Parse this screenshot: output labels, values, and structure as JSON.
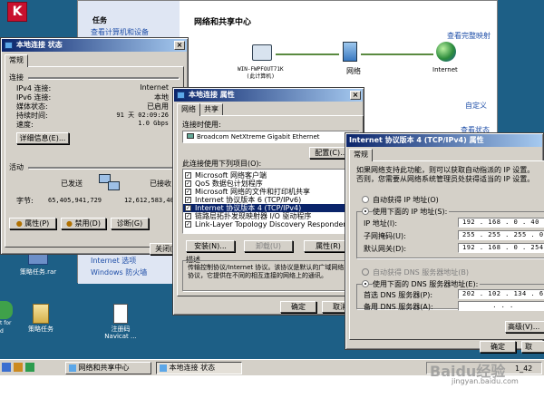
{
  "desktop": {
    "icons": [
      {
        "label": "策略任务.rar"
      },
      {
        "label": "策略任务"
      },
      {
        "label": "注册码\nNavicat ..."
      },
      {
        "label": "t for\nd"
      }
    ]
  },
  "taskbar": {
    "items": [
      "网络和共享中心",
      "本地连接 状态"
    ],
    "time": "1_42",
    "watermark": "Baidu经验",
    "watermark_url": "jingyan.baidu.com"
  },
  "ns_center": {
    "tasks_heading": "任务",
    "link_devices": "查看计算机和设备",
    "title": "网络和共享中心",
    "full_map": "查看完整映射",
    "computer": "WIN-FWPFOUT71K\n(此计算机)",
    "network": "网络",
    "internet": "Internet",
    "customize": "自定义",
    "view_status": "查看状态",
    "bottom_links": [
      "Internet 选项",
      "Windows 防火墙"
    ]
  },
  "status_win": {
    "title": "本地连接 状态",
    "tab": "常规",
    "connection_heading": "连接",
    "rows": [
      {
        "label": "IPv4 连接:",
        "value": "Internet"
      },
      {
        "label": "IPv6 连接:",
        "value": "本地"
      },
      {
        "label": "媒体状态:",
        "value": "已启用"
      },
      {
        "label": "持续时间:",
        "value": "91 天 02:09:26"
      },
      {
        "label": "速度:",
        "value": "1.0 Gbps"
      }
    ],
    "details_btn": "详细信息(E)...",
    "activity_heading": "活动",
    "sent": "已发送",
    "received": "已接收",
    "bytes_label": "字节:",
    "bytes_sent": "65,405,941,729",
    "bytes_received": "12,612,583,401",
    "btn_properties": "属性(P)",
    "btn_disable": "禁用(D)",
    "btn_diagnose": "诊断(G)",
    "btn_close": "关闭(C)"
  },
  "props_win": {
    "title": "本地连接 属性",
    "tabs": [
      "网络",
      "共享"
    ],
    "connect_using": "连接时使用:",
    "adapter": "Broadcom NetXtreme Gigabit Ethernet",
    "configure": "配置(C)...",
    "items_label": "此连接使用下列项目(O):",
    "items": [
      {
        "label": "Microsoft 网络客户端",
        "checked": true
      },
      {
        "label": "QoS 数据包计划程序",
        "checked": true
      },
      {
        "label": "Microsoft 网络的文件和打印机共享",
        "checked": true
      },
      {
        "label": "Internet 协议版本 6 (TCP/IPv6)",
        "checked": true
      },
      {
        "label": "Internet 协议版本 4 (TCP/IPv4)",
        "checked": true
      },
      {
        "label": "链路层拓扑发现映射器 I/O 驱动程序",
        "checked": true
      },
      {
        "label": "Link-Layer Topology Discovery Responder",
        "checked": true
      }
    ],
    "install": "安装(N)...",
    "uninstall": "卸载(U)",
    "properties": "属性(R)",
    "desc_heading": "描述",
    "description": "传输控制协议/Internet 协议。该协议是默认的广域网络协议，它提供在不同的相互连接的网络上的通讯。",
    "ok": "确定",
    "cancel": "取消"
  },
  "ipv4_win": {
    "title": "Internet 协议版本 4 (TCP/IPv4) 属性",
    "tab": "常规",
    "intro": "如果网络支持此功能，则可以获取自动指派的 IP 设置。否则，您需要从网络系统管理员处获得适当的 IP 设置。",
    "auto_ip": "自动获得 IP 地址(O)",
    "use_ip": "使用下面的 IP 地址(S):",
    "ip_label": "IP 地址(I):",
    "ip_value": "192 . 168 . 0 . 40",
    "mask_label": "子网掩码(U):",
    "mask_value": "255 . 255 . 255 . 0",
    "gw_label": "默认网关(D):",
    "gw_value": "192 . 168 . 0 . 254",
    "auto_dns": "自动获得 DNS 服务器地址(B)",
    "use_dns": "使用下面的 DNS 服务器地址(E):",
    "dns1_label": "首选 DNS 服务器(P):",
    "dns1_value": "202 . 102 . 134 . 68",
    "dns2_label": "备用 DNS 服务器(A):",
    "dns2_value": ". . .",
    "advanced": "高级(V)...",
    "ok": "确定",
    "cancel": "取"
  }
}
